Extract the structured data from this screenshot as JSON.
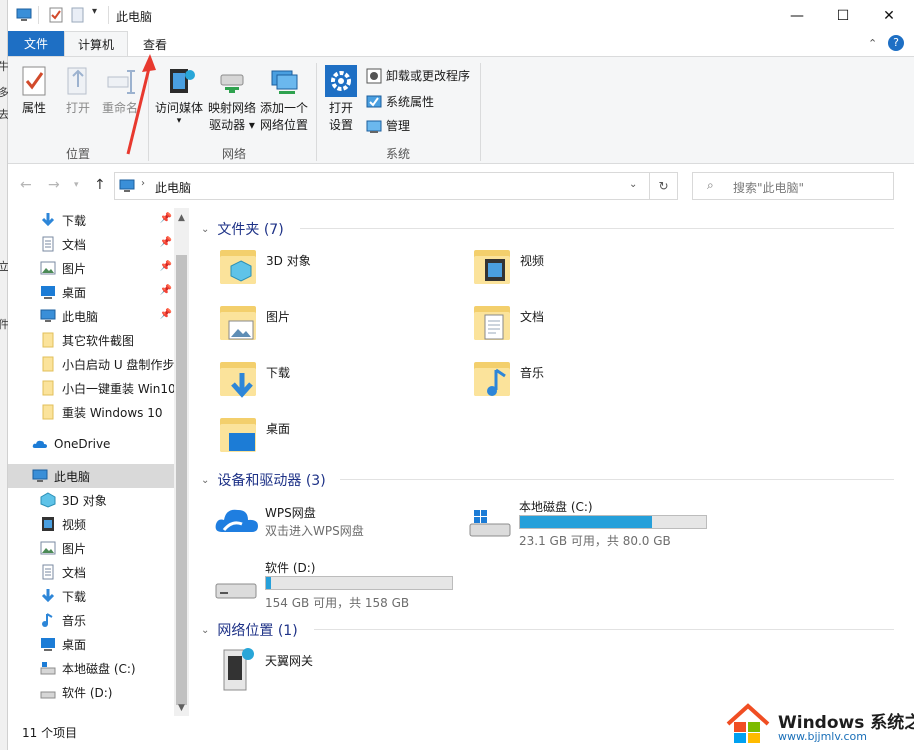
{
  "window": {
    "title": "此电脑",
    "controls": {
      "minimize": "—",
      "maximize": "☐",
      "close": "✕"
    }
  },
  "background_chars": [
    "牛",
    "多",
    "去",
    "立",
    "件"
  ],
  "ribbon": {
    "tabs": {
      "file": "文件",
      "computer": "计算机",
      "view": "查看"
    },
    "location": {
      "label": "位置",
      "properties": "属性",
      "open": "打开",
      "rename": "重命名"
    },
    "network": {
      "label": "网络",
      "media": "访问媒体",
      "map_drive_l1": "映射网络",
      "map_drive_l2": "驱动器",
      "add_location_l1": "添加一个",
      "add_location_l2": "网络位置"
    },
    "system": {
      "label": "系统",
      "open_settings_l1": "打开",
      "open_settings_l2": "设置",
      "uninstall": "卸载或更改程序",
      "system_properties": "系统属性",
      "manage": "管理"
    }
  },
  "address": {
    "path": "此电脑",
    "search_placeholder": "搜索\"此电脑\""
  },
  "navpane": {
    "quick_access": [
      {
        "label": "下载",
        "icon": "download-icon",
        "pinned": true
      },
      {
        "label": "文档",
        "icon": "document-icon",
        "pinned": true
      },
      {
        "label": "图片",
        "icon": "picture-icon",
        "pinned": true
      },
      {
        "label": "桌面",
        "icon": "desktop-icon",
        "pinned": true
      },
      {
        "label": "此电脑",
        "icon": "computer-icon",
        "pinned": true
      },
      {
        "label": "其它软件截图",
        "icon": "folder-icon",
        "pinned": false
      },
      {
        "label": "小白启动 U 盘制作步",
        "icon": "folder-icon",
        "pinned": false
      },
      {
        "label": "小白一键重装 Win10",
        "icon": "folder-icon",
        "pinned": false
      },
      {
        "label": "重装 Windows 10",
        "icon": "folder-icon",
        "pinned": false
      }
    ],
    "onedrive": "OneDrive",
    "this_pc": "此电脑",
    "this_pc_children": [
      {
        "label": "3D 对象",
        "icon": "3d-objects-icon"
      },
      {
        "label": "视频",
        "icon": "video-icon"
      },
      {
        "label": "图片",
        "icon": "picture-icon"
      },
      {
        "label": "文档",
        "icon": "document-icon"
      },
      {
        "label": "下载",
        "icon": "download-icon"
      },
      {
        "label": "音乐",
        "icon": "music-icon"
      },
      {
        "label": "桌面",
        "icon": "desktop-icon"
      },
      {
        "label": "本地磁盘 (C:)",
        "icon": "drive-c-icon"
      },
      {
        "label": "软件 (D:)",
        "icon": "drive-d-icon"
      }
    ]
  },
  "content": {
    "folders_header": "文件夹 (7)",
    "folders": [
      {
        "label": "3D 对象",
        "icon": "3d-objects-folder-icon"
      },
      {
        "label": "视频",
        "icon": "video-folder-icon"
      },
      {
        "label": "图片",
        "icon": "picture-folder-icon"
      },
      {
        "label": "文档",
        "icon": "document-folder-icon"
      },
      {
        "label": "下载",
        "icon": "download-folder-icon"
      },
      {
        "label": "音乐",
        "icon": "music-folder-icon"
      },
      {
        "label": "桌面",
        "icon": "desktop-folder-icon"
      }
    ],
    "devices_header": "设备和驱动器 (3)",
    "wps": {
      "name": "WPS网盘",
      "sub": "双击进入WPS网盘"
    },
    "drive_c": {
      "name": "本地磁盘 (C:)",
      "free": "23.1 GB 可用，共 80.0 GB",
      "used_fraction": 0.711
    },
    "drive_d": {
      "name": "软件 (D:)",
      "free": "154 GB 可用，共 158 GB",
      "used_fraction": 0.025
    },
    "network_header": "网络位置 (1)",
    "network_item": "天翼网关"
  },
  "status": {
    "count": "11 个项目"
  },
  "watermark": {
    "title": "Windows 系统之家",
    "url": "www.bjjmlv.com"
  },
  "colors": {
    "accent": "#1e6fc4",
    "header_text": "#1e3287",
    "bar_fill": "#26a0da"
  }
}
